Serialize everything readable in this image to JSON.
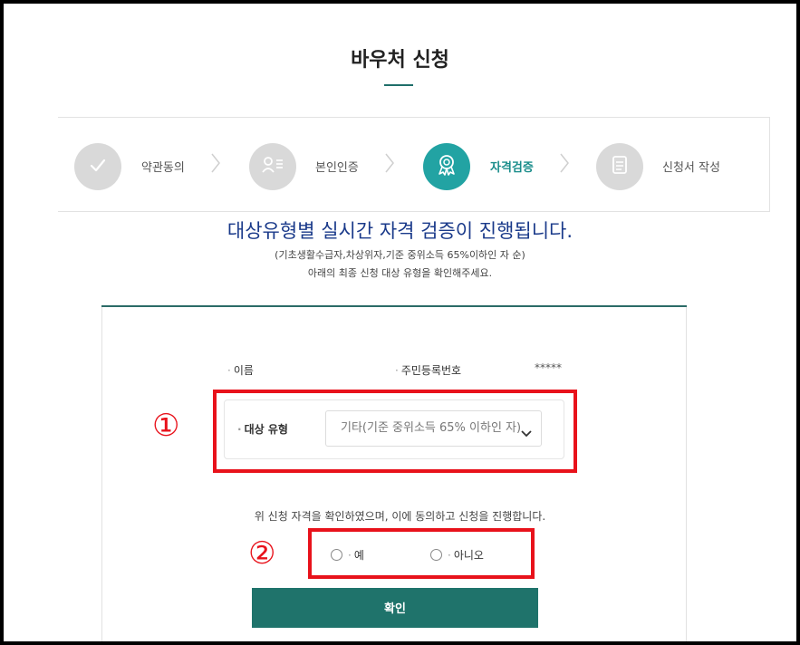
{
  "page": {
    "title": "바우처 신청"
  },
  "steps": [
    {
      "label": "약관동의",
      "icon": "check-icon",
      "active": false
    },
    {
      "label": "본인인증",
      "icon": "person-id-icon",
      "active": false
    },
    {
      "label": "자격검증",
      "icon": "award-ribbon-icon",
      "active": true
    },
    {
      "label": "신청서 작성",
      "icon": "document-icon",
      "active": false
    }
  ],
  "headline": "대상유형별 실시간 자격 검증이 진행됩니다.",
  "subtext": {
    "line1": "(기초생활수급자,차상위자,기준 중위소득 65%이하인 자 순)",
    "line2": "아래의 최종 신청 대상 유형을 확인해주세요."
  },
  "form": {
    "name_label": "이름",
    "rrn_label": "주민등록번호",
    "rrn_value": "*****",
    "target_type_label": "대상 유형",
    "target_type_selected": "기타(기준 중위소득 65% 이하인 자)"
  },
  "consent": {
    "text": "위 신청 자격을 확인하였으며, 이에 동의하고 신청을 진행합니다.",
    "yes_label": "예",
    "no_label": "아니오"
  },
  "buttons": {
    "confirm_label": "확인"
  },
  "annotations": {
    "badge1": "①",
    "badge2": "②"
  },
  "colors": {
    "accent": "#1f736b",
    "active_step": "#22a3a3",
    "highlight_border": "#e8121b",
    "headline": "#1a3a8a"
  }
}
